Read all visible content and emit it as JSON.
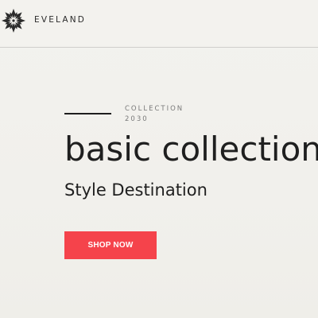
{
  "header": {
    "brand_name": "EVELAND",
    "logo_icon": "flower-ornament-icon"
  },
  "hero": {
    "eyebrow_line1": "COLLECTION",
    "eyebrow_line2": "2030",
    "title": "basic collection",
    "subtitle": "Style Destination",
    "cta_label": "SHOP NOW"
  },
  "colors": {
    "background": "#f2f1ed",
    "accent": "#f5434b",
    "text": "#1f1f1f"
  }
}
